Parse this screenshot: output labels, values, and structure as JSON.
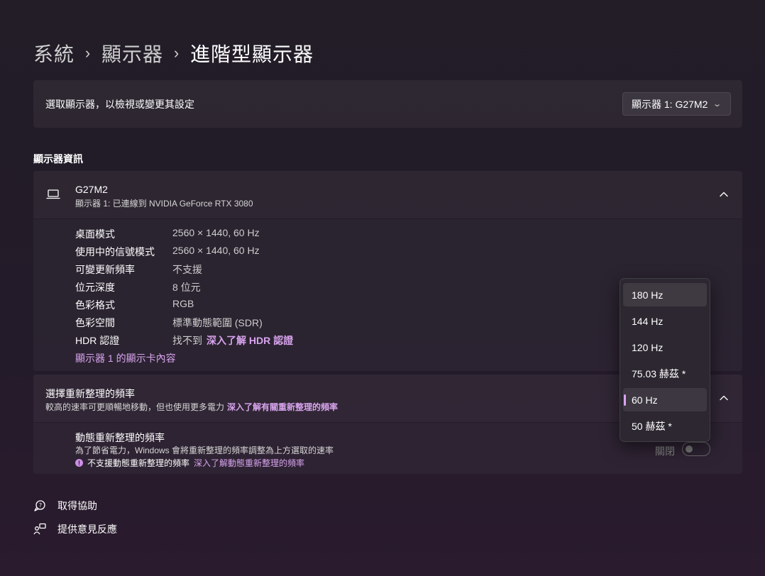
{
  "breadcrumb": {
    "items": [
      "系統",
      "顯示器",
      "進階型顯示器"
    ],
    "separator": "›"
  },
  "display_select": {
    "label": "選取顯示器，以檢視或變更其設定",
    "value": "顯示器 1: G27M2"
  },
  "display_info": {
    "section_title": "顯示器資訊",
    "monitor_name": "G27M2",
    "monitor_sub": "顯示器 1: 已連線到 NVIDIA GeForce RTX 3080",
    "properties": [
      {
        "key": "桌面模式",
        "value": "2560 × 1440, 60 Hz"
      },
      {
        "key": "使用中的信號模式",
        "value": "2560 × 1440, 60 Hz"
      },
      {
        "key": "可變更新頻率",
        "value": "不支援"
      },
      {
        "key": "位元深度",
        "value": "8 位元"
      },
      {
        "key": "色彩格式",
        "value": "RGB"
      },
      {
        "key": "色彩空間",
        "value": "標準動態範圍 (SDR)"
      },
      {
        "key": "HDR 認證",
        "value": "找不到",
        "link": "深入了解 HDR 認證"
      }
    ],
    "adapter_link": "顯示器 1 的顯示卡內容"
  },
  "refresh_rate": {
    "title": "選擇重新整理的頻率",
    "description": "較高的速率可更順暢地移動，但也使用更多電力",
    "link": "深入了解有關重新整理的頻率"
  },
  "dynamic_refresh": {
    "title": "動態重新整理的頻率",
    "description": "為了節省電力，Windows 會將重新整理的頻率調整為上方選取的速率",
    "warning": "不支援動態重新整理的頻率",
    "warning_link": "深入了解動態重新整理的頻率",
    "toggle_label": "關閉",
    "toggle_on": false
  },
  "refresh_dropdown": {
    "options": [
      "180 Hz",
      "144 Hz",
      "120 Hz",
      "75.03 赫茲 *",
      "60 Hz",
      "50 赫茲 *"
    ],
    "selected": "60 Hz",
    "hovered": "180 Hz"
  },
  "footer": {
    "help": "取得協助",
    "feedback": "提供意見反應"
  },
  "colors": {
    "accent": "#d8a4ee"
  }
}
